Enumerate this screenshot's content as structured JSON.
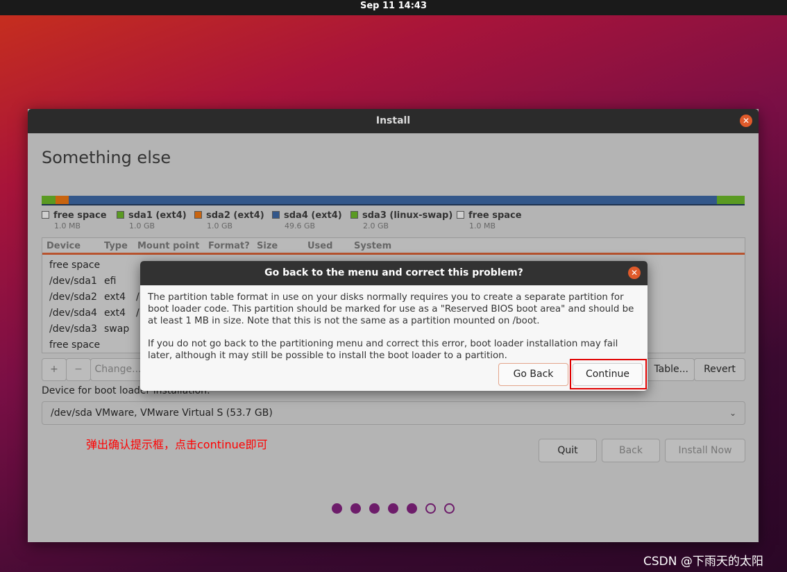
{
  "topbar": {
    "clock": "Sep 11  14:43"
  },
  "window": {
    "title": "Install",
    "heading": "Something else"
  },
  "partition_bar": [
    {
      "color": "#5a9a22",
      "fraction": 0.02
    },
    {
      "color": "#c8640f",
      "fraction": 0.019
    },
    {
      "color": "#33578a",
      "fraction": 0.922
    },
    {
      "color": "#5a9a22",
      "fraction": 0.039
    }
  ],
  "legend": [
    {
      "label": "free space",
      "size": "1.0 MB",
      "color": "#cfcfcf"
    },
    {
      "label": "sda1 (ext4)",
      "size": "1.0 GB",
      "color": "#5a9a22"
    },
    {
      "label": "sda2 (ext4)",
      "size": "1.0 GB",
      "color": "#c8640f"
    },
    {
      "label": "sda4 (ext4)",
      "size": "49.6 GB",
      "color": "#33578a"
    },
    {
      "label": "sda3 (linux-swap)",
      "size": "2.0 GB",
      "color": "#5a9a22"
    },
    {
      "label": "free space",
      "size": "1.0 MB",
      "color": "#cfcfcf"
    }
  ],
  "table": {
    "columns": [
      "Device",
      "Type",
      "Mount point",
      "Format?",
      "Size",
      "Used",
      "System"
    ],
    "rows": [
      {
        "device": "free space",
        "type": "",
        "mount": ""
      },
      {
        "device": "/dev/sda1",
        "type": "efi",
        "mount": ""
      },
      {
        "device": "/dev/sda2",
        "type": "ext4",
        "mount": "/"
      },
      {
        "device": "/dev/sda4",
        "type": "ext4",
        "mount": "/"
      },
      {
        "device": "/dev/sda3",
        "type": "swap",
        "mount": ""
      },
      {
        "device": "free space",
        "type": "",
        "mount": ""
      }
    ]
  },
  "table_buttons": {
    "add": "+",
    "remove": "−",
    "change": "Change...",
    "new_table": "Table...",
    "revert": "Revert"
  },
  "bootloader": {
    "label": "Device for boot loader installation:",
    "value": "/dev/sda   VMware, VMware Virtual S (53.7 GB)"
  },
  "annotation": "弹出确认提示框，点击continue即可",
  "nav": {
    "quit": "Quit",
    "back": "Back",
    "install": "Install Now"
  },
  "progress": {
    "current": 5,
    "total": 7
  },
  "dialog": {
    "title": "Go back to the menu and correct this problem?",
    "p1": "The partition table format in use on your disks normally requires you to create a separate partition for boot loader code. This partition should be marked for use as a \"Reserved BIOS boot area\" and should be at least 1 MB in size. Note that this is not the same as a partition mounted on /boot.",
    "p2": "If you do not go back to the partitioning menu and correct this error, boot loader installation may fail later, although it may still be possible to install the boot loader to a partition.",
    "go_back": "Go Back",
    "continue": "Continue"
  },
  "watermark": "CSDN @下雨天的太阳"
}
